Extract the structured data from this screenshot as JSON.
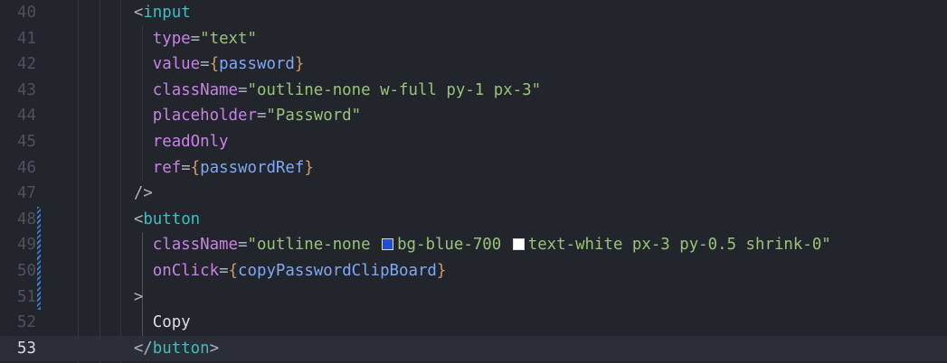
{
  "editor": {
    "current_line": 53,
    "lines": [
      {
        "n": "40",
        "text": "<input"
      },
      {
        "n": "41",
        "text": "type=\"text\""
      },
      {
        "n": "42",
        "text": "value={password}"
      },
      {
        "n": "43",
        "text": "className=\"outline-none w-full py-1 px-3\""
      },
      {
        "n": "44",
        "text": "placeholder=\"Password\""
      },
      {
        "n": "45",
        "text": "readOnly"
      },
      {
        "n": "46",
        "text": "ref={passwordRef}"
      },
      {
        "n": "47",
        "text": "/>"
      },
      {
        "n": "48",
        "text": "<button"
      },
      {
        "n": "49",
        "text": "className=\"outline-none bg-blue-700 text-white px-3 py-0.5 shrink-0\""
      },
      {
        "n": "50",
        "text": "onClick={copyPasswordClipBoard}"
      },
      {
        "n": "51",
        "text": ">"
      },
      {
        "n": "52",
        "text": "Copy"
      },
      {
        "n": "53",
        "text": "</button>"
      }
    ],
    "color_swatches": [
      {
        "class": "bg-blue-700",
        "color": "#1d4ed8"
      },
      {
        "class": "text-white",
        "color": "#ffffff"
      }
    ],
    "colors": {
      "background": "#22252b",
      "current_line": "#2a2e36",
      "line_number": "#4b5260",
      "tag": "#3cc0c2",
      "attribute": "#c882e6",
      "string": "#98c379",
      "brace": "#d19a66",
      "variable": "#7fa8f5",
      "modified_bar": "#3a7bd5"
    }
  }
}
